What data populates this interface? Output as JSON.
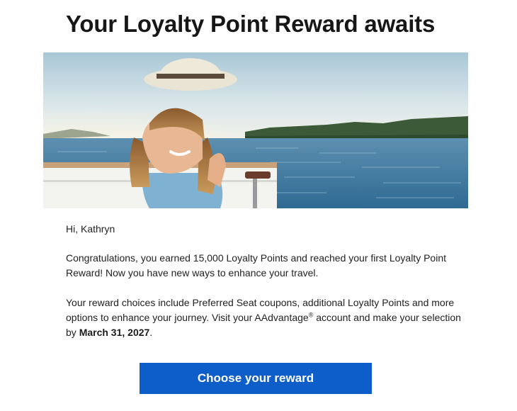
{
  "headline": "Your Loyalty Point Reward awaits",
  "hero_image": {
    "subject": "smiling woman in sun hat on a boat by the water"
  },
  "greeting": "Hi, Kathryn",
  "congrats_text": "Congratulations, you earned 15,000 Loyalty Points and reached your first Loyalty Point Reward! Now you have new ways to enhance your travel.",
  "choices": {
    "before_mark": "Your reward choices include Preferred Seat coupons, additional Loyalty Points and more options to enhance your journey. Visit your AAdvantage",
    "mark": "®",
    "after_mark": " account and make your selection by ",
    "deadline": "March 31, 2027",
    "end": "."
  },
  "cta_label": "Choose your reward",
  "colors": {
    "cta_background": "#0d5ec9",
    "cta_text": "#ffffff",
    "headline": "#171717"
  }
}
